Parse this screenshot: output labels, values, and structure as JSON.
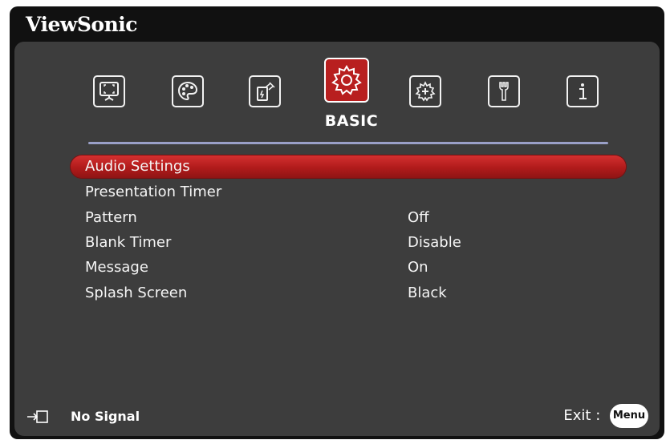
{
  "brand": "ViewSonic",
  "tabs": [
    {
      "icon": "display-icon",
      "active": false
    },
    {
      "icon": "palette-icon",
      "active": false
    },
    {
      "icon": "power-management-icon",
      "active": false
    },
    {
      "icon": "gear-icon",
      "active": true,
      "label": "BASIC"
    },
    {
      "icon": "advanced-gear-icon",
      "active": false
    },
    {
      "icon": "wrench-icon",
      "active": false
    },
    {
      "icon": "info-icon",
      "active": false
    }
  ],
  "menu": {
    "items": [
      {
        "label": "Audio Settings",
        "value": "",
        "selected": true
      },
      {
        "label": "Presentation Timer",
        "value": "",
        "selected": false
      },
      {
        "label": "Pattern",
        "value": "Off",
        "selected": false
      },
      {
        "label": "Blank Timer",
        "value": "Disable",
        "selected": false
      },
      {
        "label": "Message",
        "value": "On",
        "selected": false
      },
      {
        "label": "Splash Screen",
        "value": "Black",
        "selected": false
      }
    ]
  },
  "status": {
    "icon": "input-source-icon",
    "text": "No Signal"
  },
  "exit": {
    "label": "Exit :",
    "button": "Menu"
  },
  "colors": {
    "accent": "#b81f1f",
    "panel": "#3d3d3d",
    "frame": "#111111",
    "divider": "#9aa0c8"
  }
}
